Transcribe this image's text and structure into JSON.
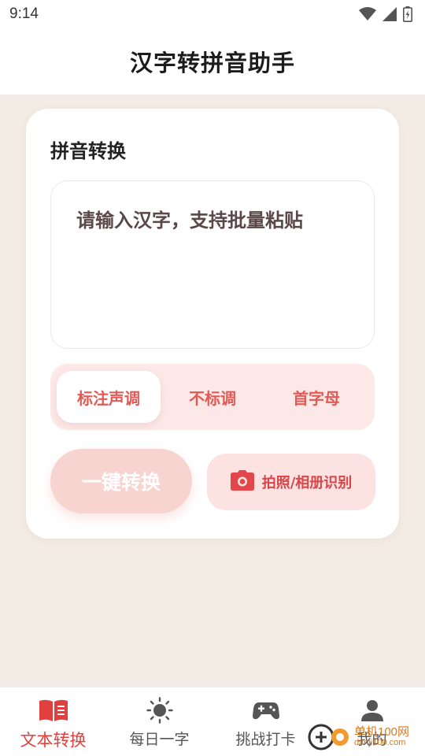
{
  "status_bar": {
    "time": "9:14"
  },
  "header": {
    "title": "汉字转拼音助手"
  },
  "card": {
    "title": "拼音转换",
    "input_placeholder": "请输入汉字，支持批量粘贴",
    "modes": [
      "标注声调",
      "不标调",
      "首字母"
    ],
    "active_mode": "标注声调",
    "convert_label": "一键转换",
    "photo_label": "拍照/相册识别"
  },
  "bottom_nav": {
    "items": [
      {
        "label": "文本转换",
        "icon": "book-icon",
        "active": true
      },
      {
        "label": "每日一字",
        "icon": "sun-icon",
        "active": false
      },
      {
        "label": "挑战打卡",
        "icon": "gamepad-icon",
        "active": false
      },
      {
        "label": "我的",
        "icon": "user-icon",
        "active": false
      }
    ]
  },
  "watermark": {
    "text": "单机100网",
    "sub": "danji100.com"
  },
  "colors": {
    "accent": "#e1403f",
    "toggle_bg": "#fce9e7",
    "convert_bg": "#f8d4d0",
    "page_bg": "#f3ece4"
  }
}
